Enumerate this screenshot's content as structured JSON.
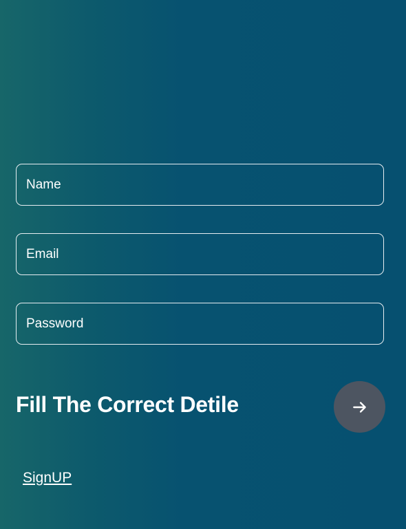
{
  "form": {
    "name_placeholder": "Name",
    "email_placeholder": "Email",
    "password_placeholder": "Password"
  },
  "prompt_text": "Fill The Correct Detile",
  "submit_icon": "arrow-right-icon",
  "signup_link": "SignUP",
  "colors": {
    "background_start": "#176669",
    "background_end": "#065070",
    "field_border": "#e8eef2",
    "submit_button_bg": "#4d5561",
    "text": "#ffffff"
  }
}
